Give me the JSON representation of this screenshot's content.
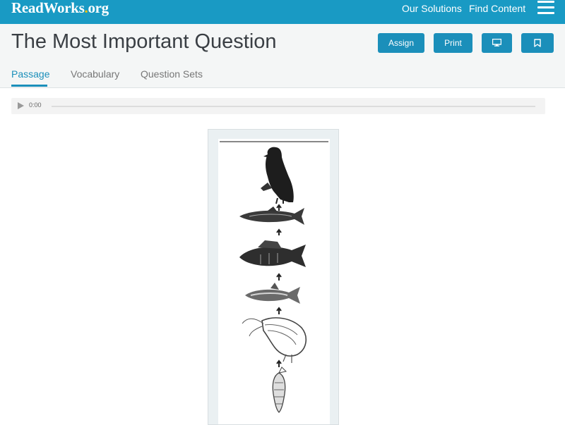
{
  "topbar": {
    "logo_text": "ReadWorks",
    "logo_dot": ".",
    "logo_suffix": "org",
    "nav": [
      "Our Solutions",
      "Find Content"
    ],
    "menu_icon": "hamburger-icon",
    "color": "#199ac4"
  },
  "header": {
    "title": "The Most Important Question",
    "buttons": {
      "assign": "Assign",
      "print": "Print",
      "present_icon": "monitor-icon",
      "bookmark_icon": "bookmark-icon"
    },
    "tabs": [
      "Passage",
      "Vocabulary",
      "Question Sets"
    ],
    "active_tab": "Passage",
    "accent": "#1b8fba"
  },
  "audio": {
    "time": "0:00",
    "play_icon": "play-icon"
  },
  "figure": {
    "subject": "food chain illustration",
    "items": [
      "hawk",
      "pike",
      "perch",
      "small fish",
      "shrimp",
      "plankton"
    ],
    "arrow_icon": "arrow-up-icon"
  }
}
